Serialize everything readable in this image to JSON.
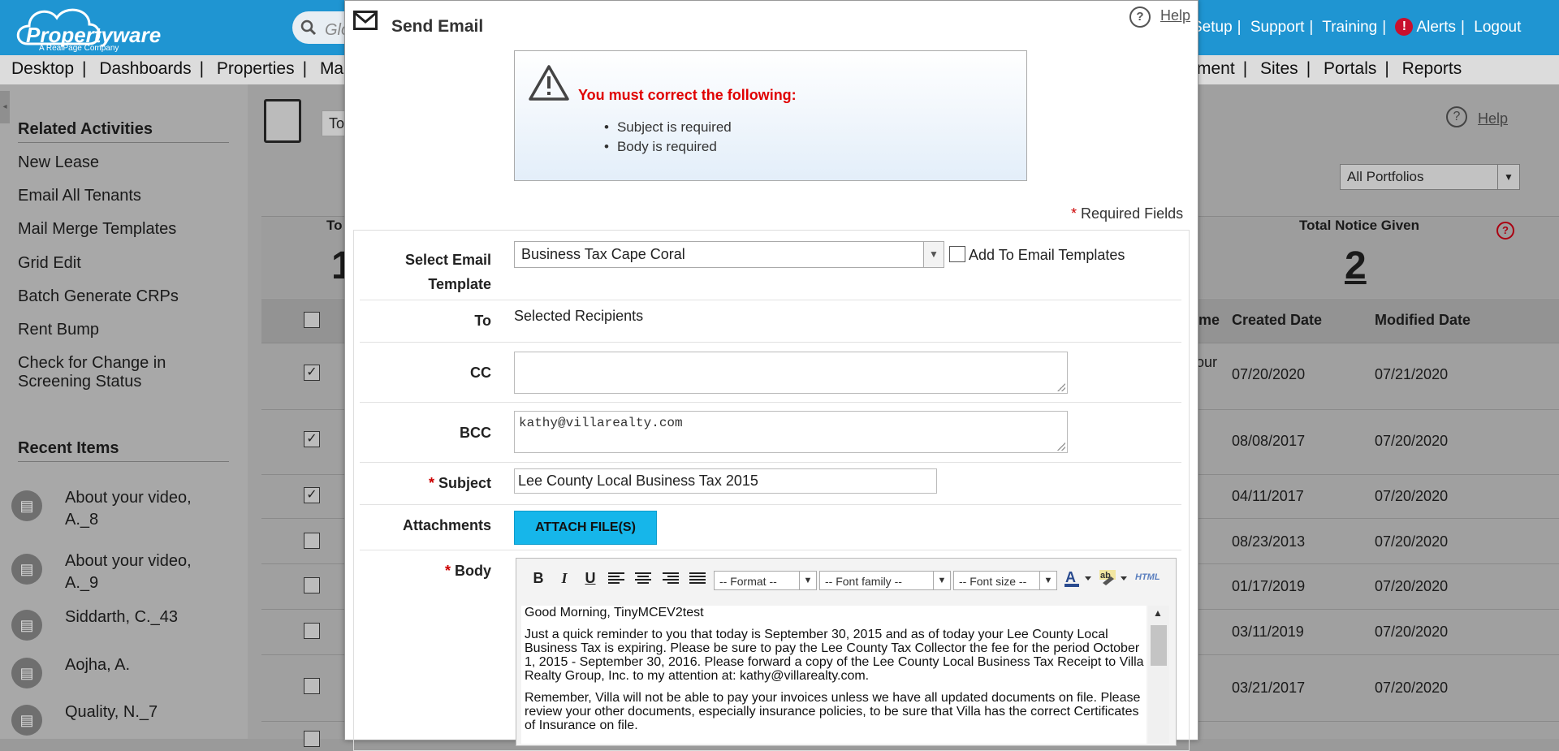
{
  "app": {
    "logo_text": "Propertyware",
    "logo_sub": "A RealPage Company",
    "search_placeholder": "Glo",
    "top_links": [
      "Setup",
      "Support",
      "Training",
      "Alerts",
      "Logout"
    ],
    "nav_left": [
      "Desktop",
      "Dashboards",
      "Properties",
      "Ma"
    ],
    "nav_right": [
      "ment",
      "Sites",
      "Portals",
      "Reports"
    ]
  },
  "sidebar": {
    "related_title": "Related Activities",
    "related": [
      "New Lease",
      "Email All Tenants",
      "Mail Merge Templates",
      "Grid Edit",
      "Batch Generate CRPs",
      "Rent Bump",
      "Check for Change in Screening Status"
    ],
    "recent_title": "Recent Items",
    "recent": [
      "About your video, A._8",
      "About your video, A._9",
      "Siddarth, C._43",
      "Aojha, A.",
      "Quality, N._7"
    ]
  },
  "main": {
    "to_box": "To",
    "help": "Help",
    "portfolio": "All Portfolios",
    "stat_left_label": "To",
    "stat_left_num": "1",
    "stat_title": "Total Notice Given",
    "stat_value": "2",
    "columns": [
      "me",
      "Created Date",
      "Modified Date"
    ],
    "rows": [
      {
        "checked": true,
        "frag": "our",
        "created": "07/20/2020",
        "modified": "07/21/2020"
      },
      {
        "checked": true,
        "frag": "",
        "created": "08/08/2017",
        "modified": "07/20/2020"
      },
      {
        "checked": true,
        "frag": "",
        "created": "04/11/2017",
        "modified": "07/20/2020"
      },
      {
        "checked": false,
        "frag": "",
        "created": "08/23/2013",
        "modified": "07/20/2020"
      },
      {
        "checked": false,
        "frag": "",
        "created": "01/17/2019",
        "modified": "07/20/2020"
      },
      {
        "checked": false,
        "frag": "",
        "created": "03/11/2019",
        "modified": "07/20/2020"
      },
      {
        "checked": false,
        "frag": "",
        "created": "03/21/2017",
        "modified": "07/20/2020"
      }
    ]
  },
  "modal": {
    "title": "Send Email",
    "help": "Help",
    "error_title": "You must correct the following:",
    "errors": [
      "Subject is required",
      "Body is required"
    ],
    "required_note": "Required Fields",
    "labels": {
      "template_line1": "Select Email",
      "template_line2": "Template",
      "to": "To",
      "cc": "CC",
      "bcc": "BCC",
      "subject": "Subject",
      "attachments": "Attachments",
      "body": "Body"
    },
    "template_value": "Business Tax Cape Coral",
    "add_to_templates": "Add To Email Templates",
    "to_value": "Selected Recipients",
    "cc_value": "",
    "bcc_value": "kathy@villarealty.com",
    "subject_value": "Lee County Local Business Tax 2015",
    "attach_button": "ATTACH FILE(S)",
    "toolbar": {
      "bold": "B",
      "italic": "I",
      "underline": "U",
      "format": "-- Format --",
      "font_family": "-- Font family --",
      "font_size": "-- Font size --",
      "html": "HTML"
    },
    "body_paragraphs": [
      "Good Morning, TinyMCEV2test",
      "Just a quick reminder to you that today is September 30, 2015 and as of today your Lee County Local Business Tax is expiring.  Please be sure to pay the Lee County Tax Collector the fee for the period October 1, 2015 - September 30, 2016. Please forward a copy of the Lee County Local Business Tax Receipt to Villa Realty Group, Inc. to my attention at: kathy@villarealty.com.",
      "Remember, Villa will not be able to pay your invoices unless we have all updated documents on file.  Please review your other documents, especially insurance policies, to be sure that Villa has the correct Certificates of Insurance on file."
    ]
  }
}
